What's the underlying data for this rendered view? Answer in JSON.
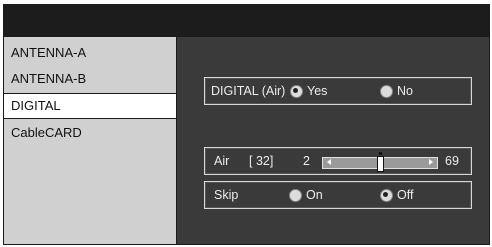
{
  "sidebar": {
    "items": [
      {
        "label": "ANTENNA-A"
      },
      {
        "label": "ANTENNA-B"
      },
      {
        "label": "DIGITAL",
        "selected": true
      },
      {
        "label": "CableCARD"
      }
    ]
  },
  "digital_air": {
    "label": "DIGITAL (Air)",
    "options": [
      {
        "label": "Yes",
        "selected": true
      },
      {
        "label": "No",
        "selected": false
      }
    ]
  },
  "channel": {
    "label": "Air",
    "current": "[ 32]",
    "min": "2",
    "max": "69",
    "value_fraction": 0.5
  },
  "skip": {
    "label": "Skip",
    "options": [
      {
        "label": "On",
        "selected": false
      },
      {
        "label": "Off",
        "selected": true
      }
    ]
  },
  "colors": {
    "background": "#3a3a3a",
    "sidebar": "#d0d0d0",
    "selected_item": "#ffffff",
    "text_light": "#ececec"
  }
}
